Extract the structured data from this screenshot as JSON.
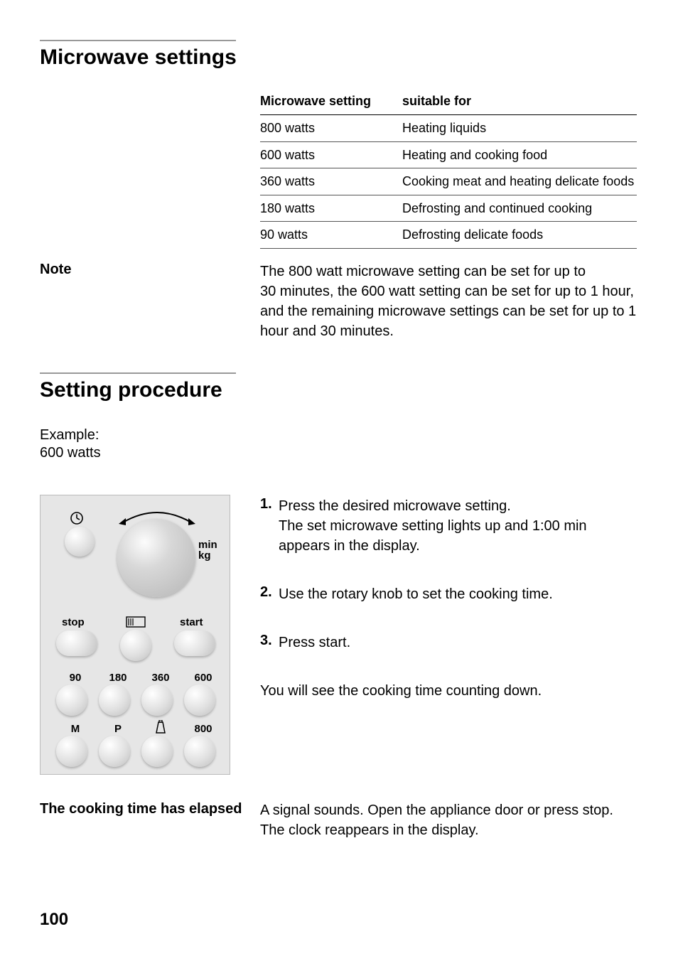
{
  "section1": {
    "heading": "Microwave settings",
    "table": {
      "head": {
        "col1": "Microwave setting",
        "col2": "suitable for"
      },
      "rows": [
        {
          "setting": "800 watts",
          "use": "Heating liquids"
        },
        {
          "setting": "600 watts",
          "use": "Heating and cooking food"
        },
        {
          "setting": "360 watts",
          "use": "Cooking meat and heating delicate foods"
        },
        {
          "setting": "180 watts",
          "use": "Defrosting and continued cooking"
        },
        {
          "setting": "90 watts",
          "use": "Defrosting delicate foods"
        }
      ]
    },
    "note_label": "Note",
    "note_text": "The 800 watt microwave setting can be set for up to 30 minutes, the 600 watt setting can be set for up to 1 hour, and the remaining microwave settings can be set for up to 1 hour and 30 minutes."
  },
  "section2": {
    "heading": "Setting procedure",
    "example_label": "Example:",
    "example_value": "600 watts",
    "panel": {
      "min": "min",
      "kg": "kg",
      "stop": "stop",
      "start": "start",
      "row3": [
        "90",
        "180",
        "360",
        "600"
      ],
      "row4": [
        "M",
        "P",
        "",
        "800"
      ]
    },
    "steps": [
      {
        "num": "1.",
        "text": "Press the desired microwave setting.\nThe set microwave setting lights up and 1:00 min appears in the display."
      },
      {
        "num": "2.",
        "text": "Use the rotary knob to set the cooking time."
      },
      {
        "num": "3.",
        "text": "Press start."
      }
    ],
    "after_steps": "You will see the cooking time counting down.",
    "elapsed_label": "The cooking time has elapsed",
    "elapsed_text": "A signal sounds. Open the appliance door or press stop. The clock reappears in the display."
  },
  "page_number": "100"
}
